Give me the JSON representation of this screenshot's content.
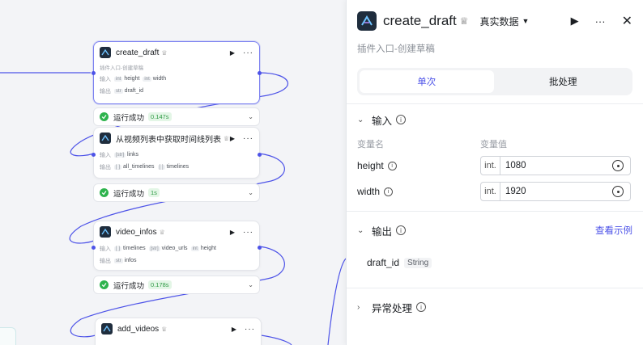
{
  "canvas": {
    "nodes": [
      {
        "title": "create_draft",
        "badge": "♕",
        "description": "插件入口-创建草稿",
        "input_label": "输入",
        "inputs": [
          {
            "type": "int",
            "name": "height"
          },
          {
            "type": "int",
            "name": "width"
          }
        ],
        "output_label": "输出",
        "outputs": [
          {
            "type": "str",
            "name": "draft_id"
          }
        ],
        "status": {
          "label": "运行成功",
          "time": "0.147s"
        }
      },
      {
        "title": "从视频列表中获取时间线列表",
        "badge": "♕",
        "input_label": "输入",
        "inputs": [
          {
            "type": "[str]",
            "name": "links"
          }
        ],
        "output_label": "输出",
        "outputs": [
          {
            "type": "[ ]",
            "name": "all_timelines"
          },
          {
            "type": "[ ]",
            "name": "timelines"
          }
        ],
        "status": {
          "label": "运行成功",
          "time": "1s"
        }
      },
      {
        "title": "video_infos",
        "badge": "♕",
        "input_label": "输入",
        "inputs": [
          {
            "type": "[ ]",
            "name": "timelines"
          },
          {
            "type": "[str]",
            "name": "video_urls"
          },
          {
            "type": "int",
            "name": "height"
          }
        ],
        "output_label": "输出",
        "outputs": [
          {
            "type": "str",
            "name": "infos"
          }
        ],
        "status": {
          "label": "运行成功",
          "time": "0.178s"
        }
      },
      {
        "title": "add_videos",
        "badge": "♕"
      }
    ]
  },
  "panel": {
    "title": "create_draft",
    "badge": "♕",
    "mode": "真实数据",
    "description": "插件入口-创建草稿",
    "tabs": [
      "单次",
      "批处理"
    ],
    "input_section": {
      "title": "输入",
      "col_name": "变量名",
      "col_value": "变量值",
      "vars": [
        {
          "name": "height",
          "type": "int.",
          "value": "1080"
        },
        {
          "name": "width",
          "type": "int.",
          "value": "1920"
        }
      ]
    },
    "output_section": {
      "title": "输出",
      "link": "查看示例",
      "vars": [
        {
          "name": "draft_id",
          "type": "String"
        }
      ]
    },
    "error_section": {
      "title": "异常处理"
    }
  },
  "colors": {
    "accent": "#4d53e8",
    "success": "#2eb34d",
    "wire": "#4d53e8"
  }
}
